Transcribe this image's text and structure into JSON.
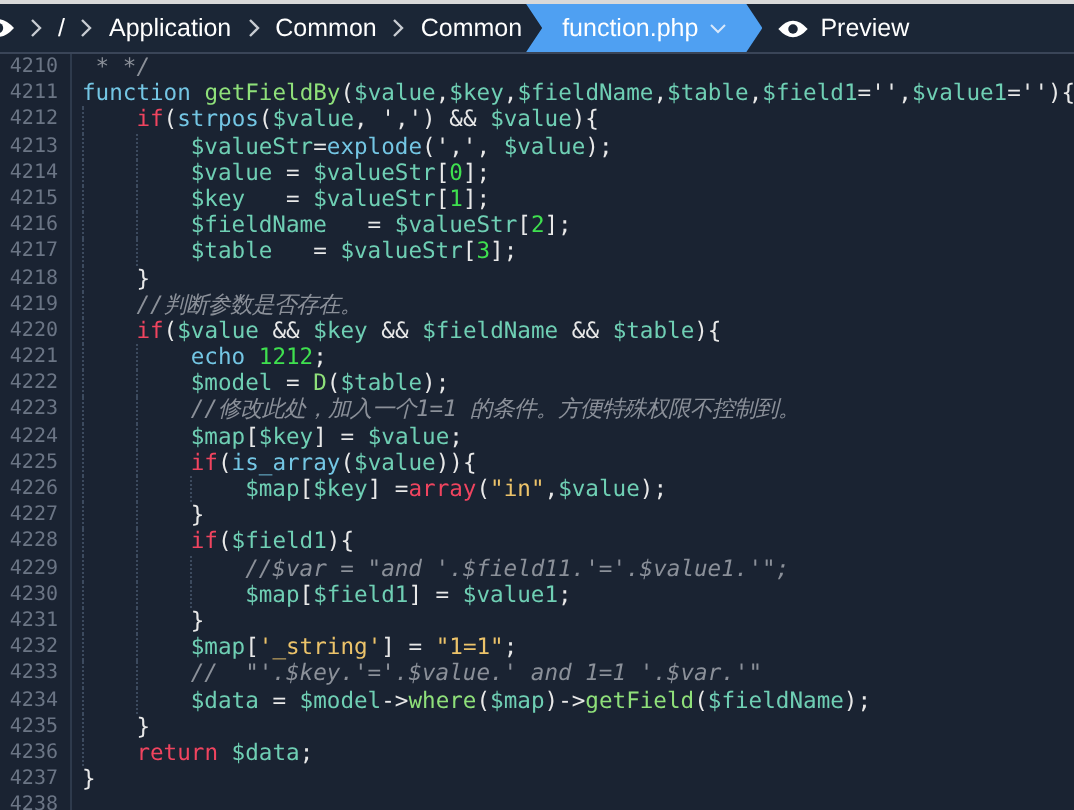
{
  "breadcrumb": {
    "items": [
      {
        "label": "/"
      },
      {
        "label": "Application"
      },
      {
        "label": "Common"
      },
      {
        "label": "Common"
      }
    ],
    "active_file": {
      "label": "function.php"
    },
    "preview": {
      "label": "Preview"
    }
  },
  "code_lines": [
    {
      "number": "4210",
      "tokens": [
        {
          "kind": "comment",
          "text": " * */"
        }
      ]
    },
    {
      "number": "4211",
      "tokens": [
        {
          "kind": "storage",
          "text": "function "
        },
        {
          "kind": "fn",
          "text": "getFieldBy"
        },
        {
          "kind": "plain",
          "text": "("
        },
        {
          "kind": "var",
          "text": "$value"
        },
        {
          "kind": "plain",
          "text": ","
        },
        {
          "kind": "var",
          "text": "$key"
        },
        {
          "kind": "plain",
          "text": ","
        },
        {
          "kind": "var",
          "text": "$fieldName"
        },
        {
          "kind": "plain",
          "text": ","
        },
        {
          "kind": "var",
          "text": "$table"
        },
        {
          "kind": "plain",
          "text": ","
        },
        {
          "kind": "var",
          "text": "$field1"
        },
        {
          "kind": "plain",
          "text": "='',"
        },
        {
          "kind": "var",
          "text": "$value1"
        },
        {
          "kind": "plain",
          "text": "=''){"
        }
      ],
      "children": [
        {
          "number": "4212",
          "tokens": [
            {
              "kind": "keyword",
              "text": "if"
            },
            {
              "kind": "plain",
              "text": "("
            },
            {
              "kind": "builtin",
              "text": "strpos"
            },
            {
              "kind": "plain",
              "text": "("
            },
            {
              "kind": "var",
              "text": "$value"
            },
            {
              "kind": "plain",
              "text": ", ',') && "
            },
            {
              "kind": "var",
              "text": "$value"
            },
            {
              "kind": "plain",
              "text": "){"
            }
          ],
          "children": [
            {
              "number": "4213",
              "tokens": [
                {
                  "kind": "var",
                  "text": "$valueStr"
                },
                {
                  "kind": "plain",
                  "text": "="
                },
                {
                  "kind": "builtin",
                  "text": "explode"
                },
                {
                  "kind": "plain",
                  "text": "(',', "
                },
                {
                  "kind": "var",
                  "text": "$value"
                },
                {
                  "kind": "plain",
                  "text": ");"
                }
              ]
            },
            {
              "number": "4214",
              "tokens": [
                {
                  "kind": "var",
                  "text": "$value"
                },
                {
                  "kind": "plain",
                  "text": " = "
                },
                {
                  "kind": "var",
                  "text": "$valueStr"
                },
                {
                  "kind": "plain",
                  "text": "["
                },
                {
                  "kind": "num",
                  "text": "0"
                },
                {
                  "kind": "plain",
                  "text": "];"
                }
              ]
            },
            {
              "number": "4215",
              "tokens": [
                {
                  "kind": "var",
                  "text": "$key"
                },
                {
                  "kind": "plain",
                  "text": "   = "
                },
                {
                  "kind": "var",
                  "text": "$valueStr"
                },
                {
                  "kind": "plain",
                  "text": "["
                },
                {
                  "kind": "num",
                  "text": "1"
                },
                {
                  "kind": "plain",
                  "text": "];"
                }
              ]
            },
            {
              "number": "4216",
              "tokens": [
                {
                  "kind": "var",
                  "text": "$fieldName"
                },
                {
                  "kind": "plain",
                  "text": "   = "
                },
                {
                  "kind": "var",
                  "text": "$valueStr"
                },
                {
                  "kind": "plain",
                  "text": "["
                },
                {
                  "kind": "num",
                  "text": "2"
                },
                {
                  "kind": "plain",
                  "text": "];"
                }
              ]
            },
            {
              "number": "4217",
              "tokens": [
                {
                  "kind": "var",
                  "text": "$table"
                },
                {
                  "kind": "plain",
                  "text": "   = "
                },
                {
                  "kind": "var",
                  "text": "$valueStr"
                },
                {
                  "kind": "plain",
                  "text": "["
                },
                {
                  "kind": "num",
                  "text": "3"
                },
                {
                  "kind": "plain",
                  "text": "];"
                }
              ]
            }
          ]
        },
        {
          "number": "4218",
          "tokens": [
            {
              "kind": "plain",
              "text": "}"
            }
          ]
        },
        {
          "number": "4219",
          "tokens": [
            {
              "kind": "comment",
              "text": "//判断参数是否存在。"
            }
          ]
        },
        {
          "number": "4220",
          "tokens": [
            {
              "kind": "keyword",
              "text": "if"
            },
            {
              "kind": "plain",
              "text": "("
            },
            {
              "kind": "var",
              "text": "$value"
            },
            {
              "kind": "plain",
              "text": " && "
            },
            {
              "kind": "var",
              "text": "$key"
            },
            {
              "kind": "plain",
              "text": " && "
            },
            {
              "kind": "var",
              "text": "$fieldName"
            },
            {
              "kind": "plain",
              "text": " && "
            },
            {
              "kind": "var",
              "text": "$table"
            },
            {
              "kind": "plain",
              "text": "){"
            }
          ],
          "children": [
            {
              "number": "4221",
              "tokens": [
                {
                  "kind": "storage",
                  "text": "echo "
                },
                {
                  "kind": "num",
                  "text": "1212"
                },
                {
                  "kind": "plain",
                  "text": ";"
                }
              ]
            },
            {
              "number": "4222",
              "tokens": [
                {
                  "kind": "var",
                  "text": "$model"
                },
                {
                  "kind": "plain",
                  "text": " = "
                },
                {
                  "kind": "fn",
                  "text": "D"
                },
                {
                  "kind": "plain",
                  "text": "("
                },
                {
                  "kind": "var",
                  "text": "$table"
                },
                {
                  "kind": "plain",
                  "text": ");"
                }
              ]
            },
            {
              "number": "4223",
              "tokens": [
                {
                  "kind": "comment",
                  "text": "//修改此处，加入一个1=1 的条件。方便特殊权限不控制到。"
                }
              ]
            },
            {
              "number": "4224",
              "tokens": [
                {
                  "kind": "var",
                  "text": "$map"
                },
                {
                  "kind": "plain",
                  "text": "["
                },
                {
                  "kind": "var",
                  "text": "$key"
                },
                {
                  "kind": "plain",
                  "text": "] = "
                },
                {
                  "kind": "var",
                  "text": "$value"
                },
                {
                  "kind": "plain",
                  "text": ";"
                }
              ]
            },
            {
              "number": "4225",
              "tokens": [
                {
                  "kind": "keyword",
                  "text": "if"
                },
                {
                  "kind": "plain",
                  "text": "("
                },
                {
                  "kind": "builtin",
                  "text": "is_array"
                },
                {
                  "kind": "plain",
                  "text": "("
                },
                {
                  "kind": "var",
                  "text": "$value"
                },
                {
                  "kind": "plain",
                  "text": ")){"
                }
              ],
              "children": [
                {
                  "number": "4226",
                  "tokens": [
                    {
                      "kind": "var",
                      "text": "$map"
                    },
                    {
                      "kind": "plain",
                      "text": "["
                    },
                    {
                      "kind": "var",
                      "text": "$key"
                    },
                    {
                      "kind": "plain",
                      "text": "] ="
                    },
                    {
                      "kind": "keyword",
                      "text": "array"
                    },
                    {
                      "kind": "plain",
                      "text": "("
                    },
                    {
                      "kind": "str",
                      "text": "\"in\""
                    },
                    {
                      "kind": "plain",
                      "text": ","
                    },
                    {
                      "kind": "var",
                      "text": "$value"
                    },
                    {
                      "kind": "plain",
                      "text": ");"
                    }
                  ]
                }
              ]
            },
            {
              "number": "4227",
              "tokens": [
                {
                  "kind": "plain",
                  "text": "}"
                }
              ]
            },
            {
              "number": "4228",
              "tokens": [
                {
                  "kind": "keyword",
                  "text": "if"
                },
                {
                  "kind": "plain",
                  "text": "("
                },
                {
                  "kind": "var",
                  "text": "$field1"
                },
                {
                  "kind": "plain",
                  "text": "){"
                }
              ],
              "children": [
                {
                  "number": "4229",
                  "tokens": [
                    {
                      "kind": "comment",
                      "text": "//$var = \"and '.$field11.'='.$value1.'\";"
                    }
                  ]
                },
                {
                  "number": "4230",
                  "tokens": [
                    {
                      "kind": "var",
                      "text": "$map"
                    },
                    {
                      "kind": "plain",
                      "text": "["
                    },
                    {
                      "kind": "var",
                      "text": "$field1"
                    },
                    {
                      "kind": "plain",
                      "text": "] = "
                    },
                    {
                      "kind": "var",
                      "text": "$value1"
                    },
                    {
                      "kind": "plain",
                      "text": ";"
                    }
                  ]
                }
              ]
            },
            {
              "number": "4231",
              "tokens": [
                {
                  "kind": "plain",
                  "text": "}"
                }
              ]
            },
            {
              "number": "4232",
              "tokens": [
                {
                  "kind": "var",
                  "text": "$map"
                },
                {
                  "kind": "plain",
                  "text": "["
                },
                {
                  "kind": "str",
                  "text": "'_string'"
                },
                {
                  "kind": "plain",
                  "text": "] = "
                },
                {
                  "kind": "str",
                  "text": "\"1=1\""
                },
                {
                  "kind": "plain",
                  "text": ";"
                }
              ]
            },
            {
              "number": "4233",
              "tokens": [
                {
                  "kind": "comment",
                  "text": "//  \"'.$key.'='.$value.' and 1=1 '.$var.'\""
                }
              ]
            },
            {
              "number": "4234",
              "tokens": [
                {
                  "kind": "var",
                  "text": "$data"
                },
                {
                  "kind": "plain",
                  "text": " = "
                },
                {
                  "kind": "var",
                  "text": "$model"
                },
                {
                  "kind": "plain",
                  "text": "->"
                },
                {
                  "kind": "fn",
                  "text": "where"
                },
                {
                  "kind": "plain",
                  "text": "("
                },
                {
                  "kind": "var",
                  "text": "$map"
                },
                {
                  "kind": "plain",
                  "text": ")->"
                },
                {
                  "kind": "fn",
                  "text": "getField"
                },
                {
                  "kind": "plain",
                  "text": "("
                },
                {
                  "kind": "var",
                  "text": "$fieldName"
                },
                {
                  "kind": "plain",
                  "text": ");"
                }
              ]
            }
          ]
        },
        {
          "number": "4235",
          "tokens": [
            {
              "kind": "plain",
              "text": "}"
            }
          ]
        },
        {
          "number": "4236",
          "tokens": [
            {
              "kind": "keyword",
              "text": "return "
            },
            {
              "kind": "var",
              "text": "$data"
            },
            {
              "kind": "plain",
              "text": ";"
            }
          ]
        }
      ]
    },
    {
      "number": "4237",
      "tokens": [
        {
          "kind": "plain",
          "text": "}"
        }
      ]
    },
    {
      "number": "4238"
    }
  ]
}
